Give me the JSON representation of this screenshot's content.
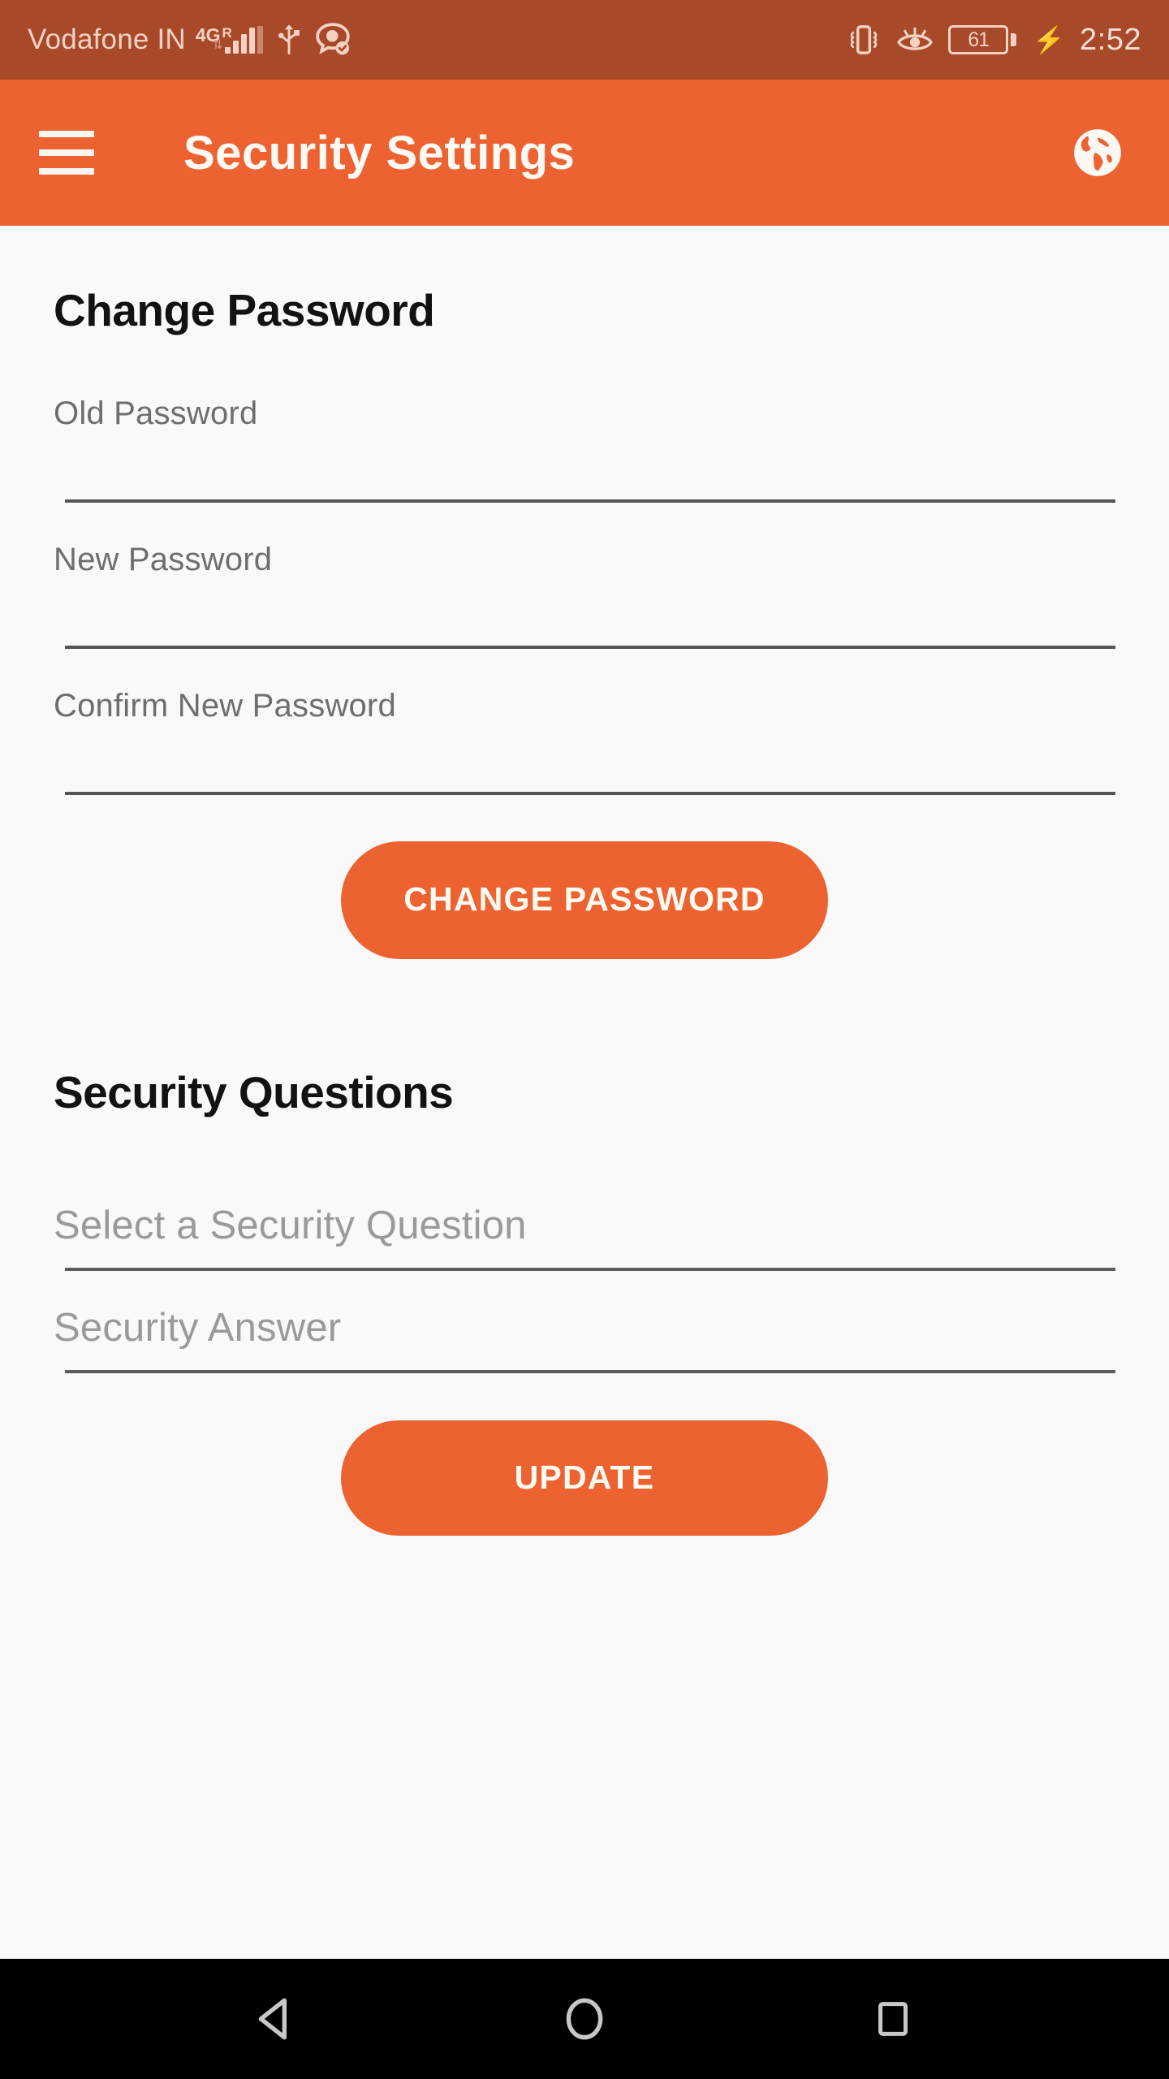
{
  "status_bar": {
    "carrier": "Vodafone IN",
    "network_type": "4G",
    "roaming_flag": "R",
    "data_arrows": "⇅",
    "signal_icon": "signal-bars-icon",
    "usb_icon": "usb-icon",
    "messaging_icon": "messaging-icon",
    "vibrate_icon": "vibrate-icon",
    "eye_comfort_icon": "eye-comfort-icon",
    "battery_level": "61",
    "charging_icon": "charging-bolt-icon",
    "time": "2:52"
  },
  "app_bar": {
    "menu_icon": "hamburger-menu-icon",
    "title": "Security Settings",
    "language_icon": "globe-icon"
  },
  "change_password": {
    "heading": "Change Password",
    "fields": [
      {
        "label": "Old Password",
        "value": "",
        "name": "old-password-field"
      },
      {
        "label": "New Password",
        "value": "",
        "name": "new-password-field"
      },
      {
        "label": "Confirm New Password",
        "value": "",
        "name": "confirm-new-password-field"
      }
    ],
    "submit_label": "CHANGE PASSWORD"
  },
  "security_questions": {
    "heading": "Security Questions",
    "question_placeholder": "Select a Security Question",
    "question_value": "",
    "answer_placeholder": "Security Answer",
    "answer_value": "",
    "submit_label": "UPDATE"
  },
  "nav_bar": {
    "back_icon": "back-triangle-icon",
    "home_icon": "home-circle-icon",
    "recents_icon": "recents-square-icon"
  },
  "colors": {
    "status_bar": "#a8492a",
    "app_bar": "#ec6331",
    "accent": "#ec6331",
    "page_background": "#f9f9f9",
    "heading_text": "#121212",
    "label_text": "#6e6e6e",
    "placeholder_text": "#9a9a9a",
    "underline": "#555555",
    "nav_bar": "#000000"
  }
}
